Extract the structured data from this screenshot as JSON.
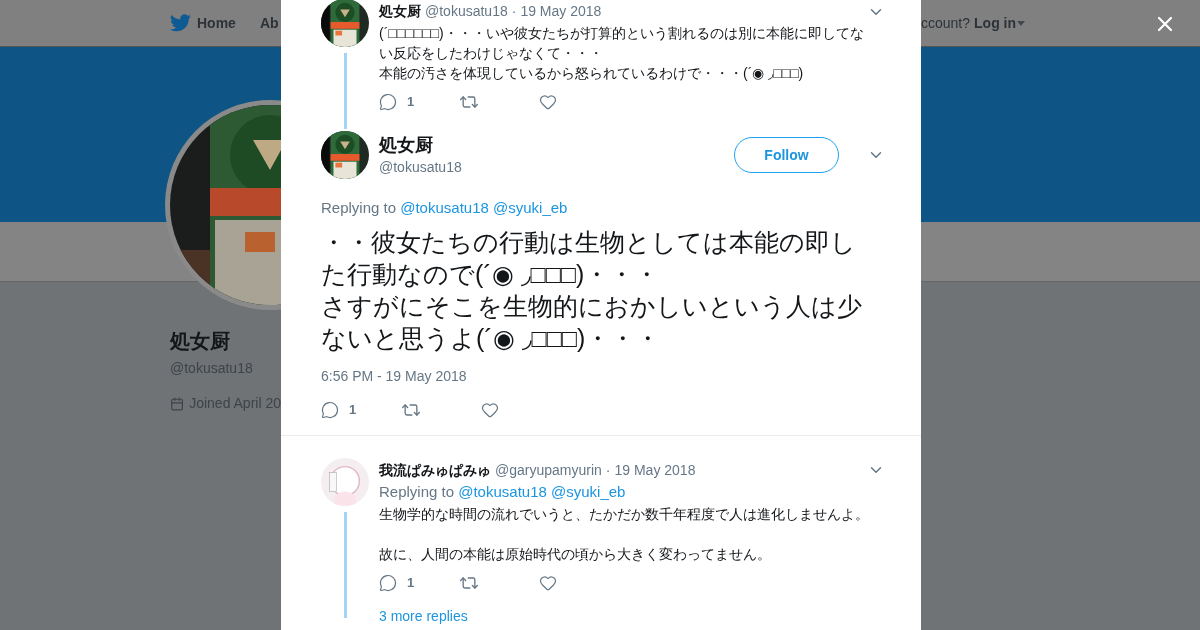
{
  "nav": {
    "items": [
      {
        "label": "Home",
        "selected": false
      },
      {
        "label": "Ab",
        "selected": false
      }
    ],
    "account_prompt": "ccount?",
    "login": "Log in"
  },
  "profile": {
    "name": "処女厨",
    "handle": "@tokusatu18",
    "joined": "Joined April 20"
  },
  "tweets": [
    {
      "kind": "reply",
      "name": "処女厨",
      "handle": "@tokusatu18",
      "separator": "·",
      "date": "19 May 2018",
      "paragraphs": [
        "(´□□□□□□)・・・いや彼女たちが打算的という割れるのは別に本能に即してない反応をしたわけじゃなくて・・・",
        "本能の汚さを体現しているから怒られているわけで・・・(´◉ ◞□□□)"
      ],
      "spaced": false,
      "replies": "1",
      "thread": true
    },
    {
      "kind": "focus",
      "name": "処女厨",
      "handle": "@tokusatu18",
      "follow": "Follow",
      "replying_label": "Replying to",
      "mentions": [
        "@tokusatu18",
        "@syuki_eb"
      ],
      "paragraphs": [
        "・・彼女たちの行動は生物としては本能の即した行動なので(´◉ ◞□□□)・・・",
        "さすがにそこを生物的におかしいという人は少ないと思うよ(´◉ ◞□□□)・・・"
      ],
      "spaced": false,
      "timestamp": "6:56 PM - 19 May 2018",
      "replies": "1",
      "thread": false
    },
    {
      "kind": "reply",
      "name": "我流ぱみゅぱみゅ",
      "handle": "@garyupamyurin",
      "separator": "·",
      "date": "19 May 2018",
      "replying_label": "Replying to",
      "mentions": [
        "@tokusatu18",
        "@syuki_eb"
      ],
      "paragraphs": [
        "生物学的な時間の流れでいうと、たかだか数千年程度で人は進化しませんよ。",
        "故に、人間の本能は原始時代の頃から大きく変わってません。"
      ],
      "spaced": true,
      "replies": "1",
      "thread": true
    }
  ],
  "more_replies": "3 more replies"
}
